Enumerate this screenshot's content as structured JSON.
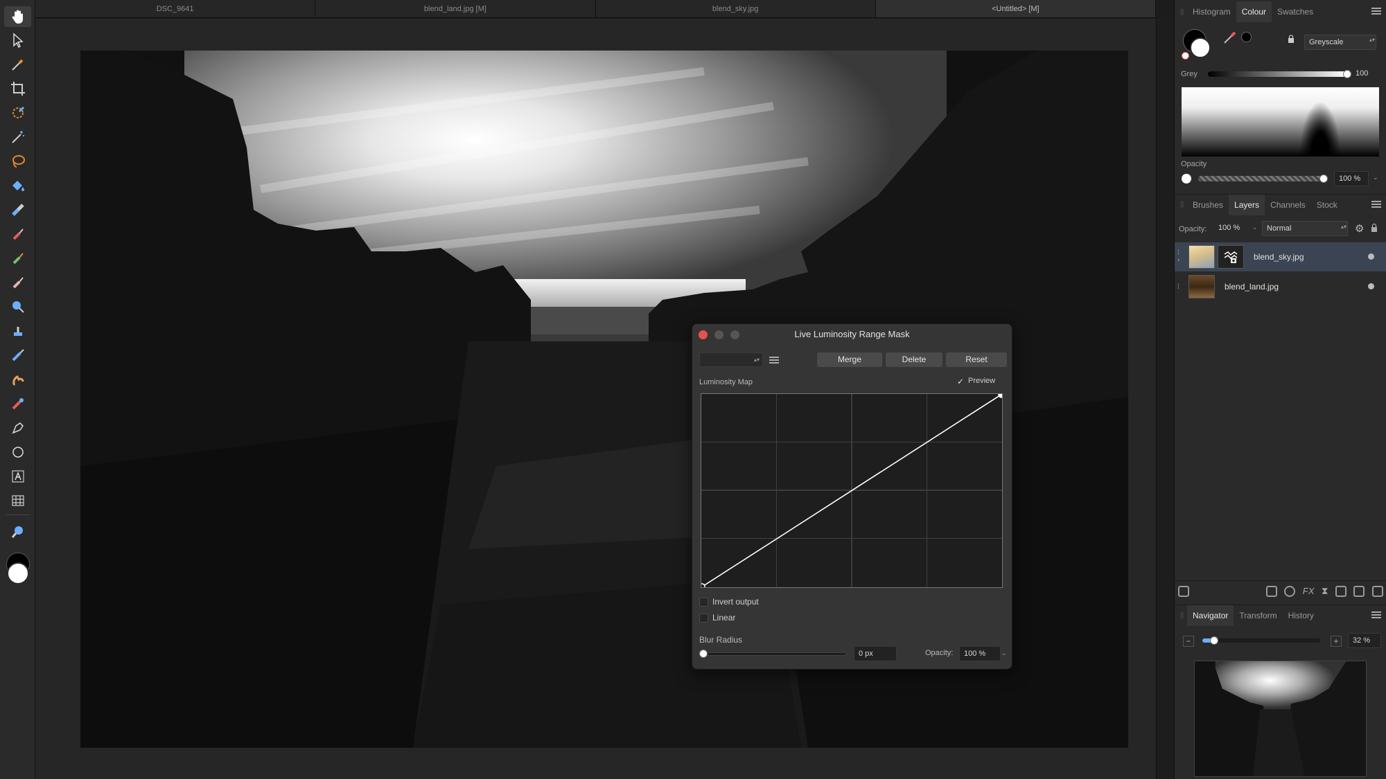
{
  "document_tabs": [
    "DSC_9641",
    "blend_land.jpg [M]",
    "blend_sky.jpg",
    "<Untitled> [M]"
  ],
  "colour_panel": {
    "tabs": [
      "Histogram",
      "Colour",
      "Swatches"
    ],
    "active_tab": "Colour",
    "model": "Greyscale",
    "grey_label": "Grey",
    "grey_value": "100",
    "opacity_label": "Opacity",
    "opacity_value": "100 %"
  },
  "layers_panel": {
    "tabs": [
      "Brushes",
      "Layers",
      "Channels",
      "Stock"
    ],
    "active_tab": "Layers",
    "opacity_label": "Opacity:",
    "opacity_value": "100 %",
    "blend_mode": "Normal",
    "layers": [
      {
        "name": "blend_sky.jpg",
        "selected": true
      },
      {
        "name": "blend_land.jpg",
        "selected": false
      }
    ]
  },
  "navigator_panel": {
    "tabs": [
      "Navigator",
      "Transform",
      "History"
    ],
    "active_tab": "Navigator",
    "zoom": "32 %",
    "zoom_fraction": 0.1
  },
  "dialog": {
    "title": "Live Luminosity Range Mask",
    "merge_label": "Merge",
    "delete_label": "Delete",
    "reset_label": "Reset",
    "map_label": "Luminosity Map",
    "preview_label": "Preview",
    "preview_checked": true,
    "invert_label": "Invert output",
    "linear_label": "Linear",
    "blur_label": "Blur Radius",
    "blur_value": "0 px",
    "opacity_label": "Opacity:",
    "opacity_value": "100 %"
  },
  "colors": {
    "accent_blue": "#3a4452",
    "close_red": "#e5534b"
  },
  "tools": [
    "hand-tool-icon",
    "move-tool-icon",
    "color-picker-icon",
    "crop-icon",
    "selection-brush-icon",
    "magic-wand-icon",
    "freehand-selection-icon",
    "flood-fill-icon",
    "gradient-icon",
    "paint-brush-icon",
    "color-replacement-icon",
    "erase-brush-icon",
    "dodge-icon",
    "clone-icon",
    "healing-icon",
    "smudge-icon",
    "red-eye-icon",
    "pen-icon",
    "ellipse-icon",
    "text-icon",
    "mesh-warp-icon",
    "zoom-icon"
  ]
}
